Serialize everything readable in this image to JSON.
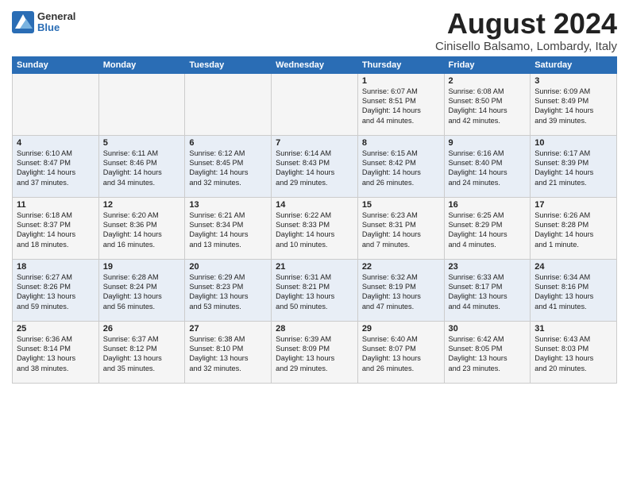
{
  "logo": {
    "general": "General",
    "blue": "Blue"
  },
  "title": "August 2024",
  "location": "Cinisello Balsamo, Lombardy, Italy",
  "headers": [
    "Sunday",
    "Monday",
    "Tuesday",
    "Wednesday",
    "Thursday",
    "Friday",
    "Saturday"
  ],
  "weeks": [
    [
      {
        "day": "",
        "info": ""
      },
      {
        "day": "",
        "info": ""
      },
      {
        "day": "",
        "info": ""
      },
      {
        "day": "",
        "info": ""
      },
      {
        "day": "1",
        "info": "Sunrise: 6:07 AM\nSunset: 8:51 PM\nDaylight: 14 hours\nand 44 minutes."
      },
      {
        "day": "2",
        "info": "Sunrise: 6:08 AM\nSunset: 8:50 PM\nDaylight: 14 hours\nand 42 minutes."
      },
      {
        "day": "3",
        "info": "Sunrise: 6:09 AM\nSunset: 8:49 PM\nDaylight: 14 hours\nand 39 minutes."
      }
    ],
    [
      {
        "day": "4",
        "info": "Sunrise: 6:10 AM\nSunset: 8:47 PM\nDaylight: 14 hours\nand 37 minutes."
      },
      {
        "day": "5",
        "info": "Sunrise: 6:11 AM\nSunset: 8:46 PM\nDaylight: 14 hours\nand 34 minutes."
      },
      {
        "day": "6",
        "info": "Sunrise: 6:12 AM\nSunset: 8:45 PM\nDaylight: 14 hours\nand 32 minutes."
      },
      {
        "day": "7",
        "info": "Sunrise: 6:14 AM\nSunset: 8:43 PM\nDaylight: 14 hours\nand 29 minutes."
      },
      {
        "day": "8",
        "info": "Sunrise: 6:15 AM\nSunset: 8:42 PM\nDaylight: 14 hours\nand 26 minutes."
      },
      {
        "day": "9",
        "info": "Sunrise: 6:16 AM\nSunset: 8:40 PM\nDaylight: 14 hours\nand 24 minutes."
      },
      {
        "day": "10",
        "info": "Sunrise: 6:17 AM\nSunset: 8:39 PM\nDaylight: 14 hours\nand 21 minutes."
      }
    ],
    [
      {
        "day": "11",
        "info": "Sunrise: 6:18 AM\nSunset: 8:37 PM\nDaylight: 14 hours\nand 18 minutes."
      },
      {
        "day": "12",
        "info": "Sunrise: 6:20 AM\nSunset: 8:36 PM\nDaylight: 14 hours\nand 16 minutes."
      },
      {
        "day": "13",
        "info": "Sunrise: 6:21 AM\nSunset: 8:34 PM\nDaylight: 14 hours\nand 13 minutes."
      },
      {
        "day": "14",
        "info": "Sunrise: 6:22 AM\nSunset: 8:33 PM\nDaylight: 14 hours\nand 10 minutes."
      },
      {
        "day": "15",
        "info": "Sunrise: 6:23 AM\nSunset: 8:31 PM\nDaylight: 14 hours\nand 7 minutes."
      },
      {
        "day": "16",
        "info": "Sunrise: 6:25 AM\nSunset: 8:29 PM\nDaylight: 14 hours\nand 4 minutes."
      },
      {
        "day": "17",
        "info": "Sunrise: 6:26 AM\nSunset: 8:28 PM\nDaylight: 14 hours\nand 1 minute."
      }
    ],
    [
      {
        "day": "18",
        "info": "Sunrise: 6:27 AM\nSunset: 8:26 PM\nDaylight: 13 hours\nand 59 minutes."
      },
      {
        "day": "19",
        "info": "Sunrise: 6:28 AM\nSunset: 8:24 PM\nDaylight: 13 hours\nand 56 minutes."
      },
      {
        "day": "20",
        "info": "Sunrise: 6:29 AM\nSunset: 8:23 PM\nDaylight: 13 hours\nand 53 minutes."
      },
      {
        "day": "21",
        "info": "Sunrise: 6:31 AM\nSunset: 8:21 PM\nDaylight: 13 hours\nand 50 minutes."
      },
      {
        "day": "22",
        "info": "Sunrise: 6:32 AM\nSunset: 8:19 PM\nDaylight: 13 hours\nand 47 minutes."
      },
      {
        "day": "23",
        "info": "Sunrise: 6:33 AM\nSunset: 8:17 PM\nDaylight: 13 hours\nand 44 minutes."
      },
      {
        "day": "24",
        "info": "Sunrise: 6:34 AM\nSunset: 8:16 PM\nDaylight: 13 hours\nand 41 minutes."
      }
    ],
    [
      {
        "day": "25",
        "info": "Sunrise: 6:36 AM\nSunset: 8:14 PM\nDaylight: 13 hours\nand 38 minutes."
      },
      {
        "day": "26",
        "info": "Sunrise: 6:37 AM\nSunset: 8:12 PM\nDaylight: 13 hours\nand 35 minutes."
      },
      {
        "day": "27",
        "info": "Sunrise: 6:38 AM\nSunset: 8:10 PM\nDaylight: 13 hours\nand 32 minutes."
      },
      {
        "day": "28",
        "info": "Sunrise: 6:39 AM\nSunset: 8:09 PM\nDaylight: 13 hours\nand 29 minutes."
      },
      {
        "day": "29",
        "info": "Sunrise: 6:40 AM\nSunset: 8:07 PM\nDaylight: 13 hours\nand 26 minutes."
      },
      {
        "day": "30",
        "info": "Sunrise: 6:42 AM\nSunset: 8:05 PM\nDaylight: 13 hours\nand 23 minutes."
      },
      {
        "day": "31",
        "info": "Sunrise: 6:43 AM\nSunset: 8:03 PM\nDaylight: 13 hours\nand 20 minutes."
      }
    ]
  ]
}
